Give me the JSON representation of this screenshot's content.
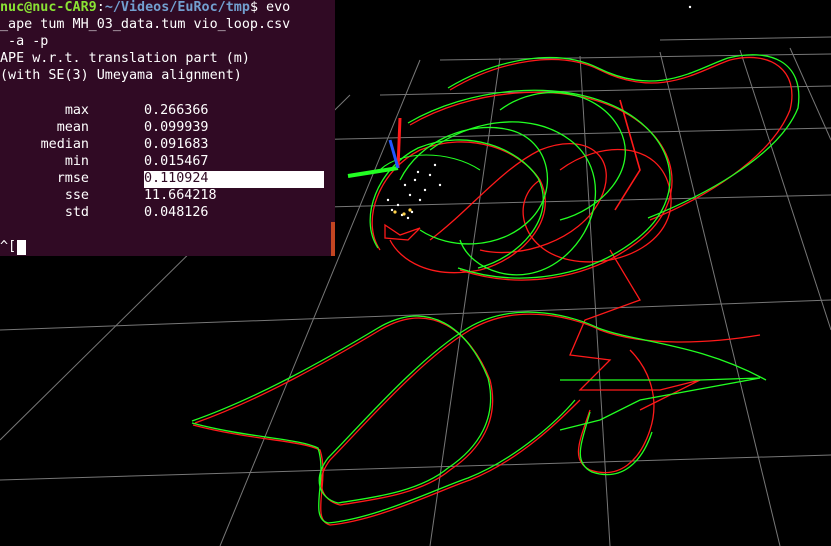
{
  "viewer": {
    "background": "#000000",
    "grid_color": "#8c8c8c",
    "ground_truth_color": "#22ff22",
    "estimate_color": "#ff1a1a"
  },
  "terminal": {
    "prompt_user": "nuc@nuc-CAR9",
    "prompt_sep": ":",
    "prompt_path": "~/Videos/EuRoc/tmp",
    "prompt_symbol": "$ evo",
    "command_line2": "_ape tum MH_03_data.tum vio_loop.csv",
    "command_line3": " -a -p",
    "output_title": "APE w.r.t. translation part (m)",
    "output_subtitle": "(with SE(3) Umeyama alignment)",
    "stats": [
      {
        "label": "max",
        "value": "0.266366"
      },
      {
        "label": "mean",
        "value": "0.099939"
      },
      {
        "label": "median",
        "value": "0.091683"
      },
      {
        "label": "min",
        "value": "0.015467"
      },
      {
        "label": "rmse",
        "value": "0.110924"
      },
      {
        "label": "sse",
        "value": "11.664218"
      },
      {
        "label": "std",
        "value": "0.048126"
      }
    ],
    "input_text": "^["
  }
}
